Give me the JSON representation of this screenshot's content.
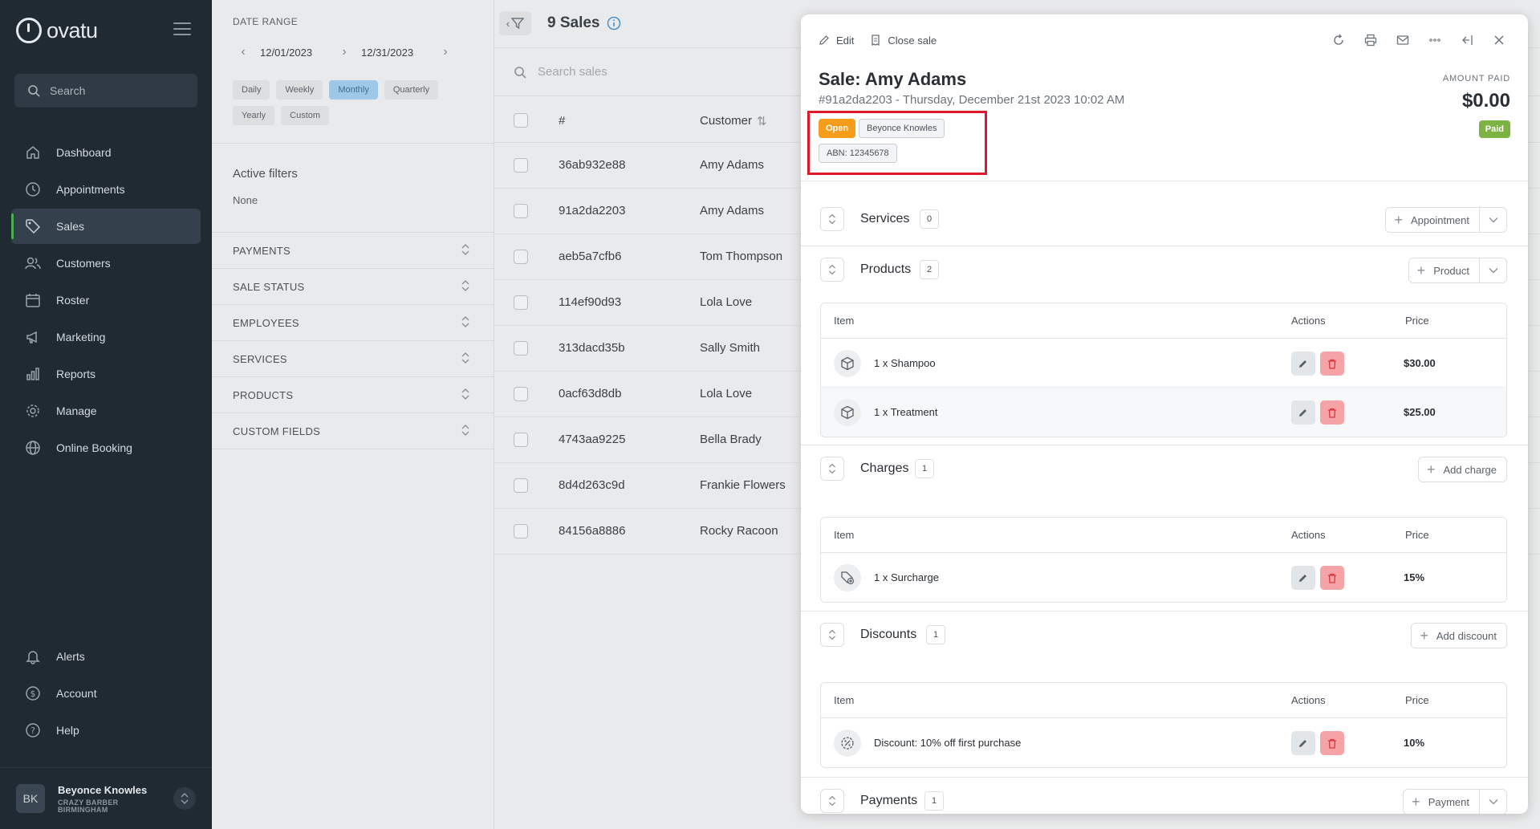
{
  "sidebar": {
    "logo_text": "ovatu",
    "search_placeholder": "Search",
    "items": [
      {
        "label": "Dashboard",
        "icon": "home-icon"
      },
      {
        "label": "Appointments",
        "icon": "clock-icon"
      },
      {
        "label": "Sales",
        "icon": "tag-icon",
        "active": true
      },
      {
        "label": "Customers",
        "icon": "users-icon"
      },
      {
        "label": "Roster",
        "icon": "calendar-icon"
      },
      {
        "label": "Marketing",
        "icon": "megaphone-icon"
      },
      {
        "label": "Reports",
        "icon": "bar-chart-icon"
      },
      {
        "label": "Manage",
        "icon": "gear-icon"
      },
      {
        "label": "Online Booking",
        "icon": "globe-icon"
      }
    ],
    "bottom_items": [
      {
        "label": "Alerts",
        "icon": "bell-icon"
      },
      {
        "label": "Account",
        "icon": "dollar-icon"
      },
      {
        "label": "Help",
        "icon": "help-icon"
      }
    ],
    "user": {
      "initials": "BK",
      "name": "Beyonce Knowles",
      "line1": "CRAZY BARBER",
      "line2": "BIRMINGHAM"
    }
  },
  "filters": {
    "date_range_label": "DATE RANGE",
    "start_date": "12/01/2023",
    "end_date": "12/31/2023",
    "periods": [
      "Daily",
      "Weekly",
      "Monthly",
      "Quarterly",
      "Yearly",
      "Custom"
    ],
    "active_period": "Monthly",
    "active_filters_title": "Active filters",
    "active_filters_value": "None",
    "sections": [
      "PAYMENTS",
      "SALE STATUS",
      "EMPLOYEES",
      "SERVICES",
      "PRODUCTS",
      "CUSTOM FIELDS"
    ]
  },
  "list": {
    "title": "9 Sales",
    "search_placeholder": "Search sales",
    "col_number": "#",
    "col_customer": "Customer",
    "rows": [
      {
        "id": "36ab932e88",
        "customer": "Amy Adams"
      },
      {
        "id": "91a2da2203",
        "customer": "Amy Adams"
      },
      {
        "id": "aeb5a7cfb6",
        "customer": "Tom Thompson"
      },
      {
        "id": "114ef90d93",
        "customer": "Lola Love"
      },
      {
        "id": "313dacd35b",
        "customer": "Sally Smith"
      },
      {
        "id": "0acf63d8db",
        "customer": "Lola Love"
      },
      {
        "id": "4743aa9225",
        "customer": "Bella Brady"
      },
      {
        "id": "8d4d263c9d",
        "customer": "Frankie Flowers"
      },
      {
        "id": "84156a8886",
        "customer": "Rocky Racoon"
      }
    ]
  },
  "sale": {
    "toolbar": {
      "edit": "Edit",
      "close_sale": "Close sale"
    },
    "title": "Sale: Amy Adams",
    "subtitle": "#91a2da2203 - Thursday, December 21st 2023 10:02 AM",
    "amount_label": "AMOUNT PAID",
    "amount": "$0.00",
    "paid_badge": "Paid",
    "tags": {
      "status": "Open",
      "employee": "Beyonce Knowles",
      "abn": "ABN: 12345678"
    },
    "table_headers": {
      "item": "Item",
      "actions": "Actions",
      "price": "Price"
    },
    "services": {
      "title": "Services",
      "count": "0",
      "button": "Appointment"
    },
    "products": {
      "title": "Products",
      "count": "2",
      "button": "Product",
      "items": [
        {
          "name": "1 x Shampoo",
          "price": "$30.00"
        },
        {
          "name": "1 x Treatment",
          "price": "$25.00"
        }
      ]
    },
    "charges": {
      "title": "Charges",
      "count": "1",
      "button": "Add charge",
      "items": [
        {
          "name": "1 x Surcharge",
          "price": "15%"
        }
      ]
    },
    "discounts": {
      "title": "Discounts",
      "count": "1",
      "button": "Add discount",
      "items": [
        {
          "name": "Discount: 10% off first purchase",
          "price": "10%"
        }
      ]
    },
    "payments": {
      "title": "Payments",
      "count": "1",
      "button": "Payment"
    }
  },
  "colors": {
    "sidebar_bg": "#1f2a33",
    "open_tag": "#f59c1a",
    "paid_badge": "#7cb342",
    "delete_btn": "#f6a3a7",
    "highlight": "#e0182a"
  }
}
